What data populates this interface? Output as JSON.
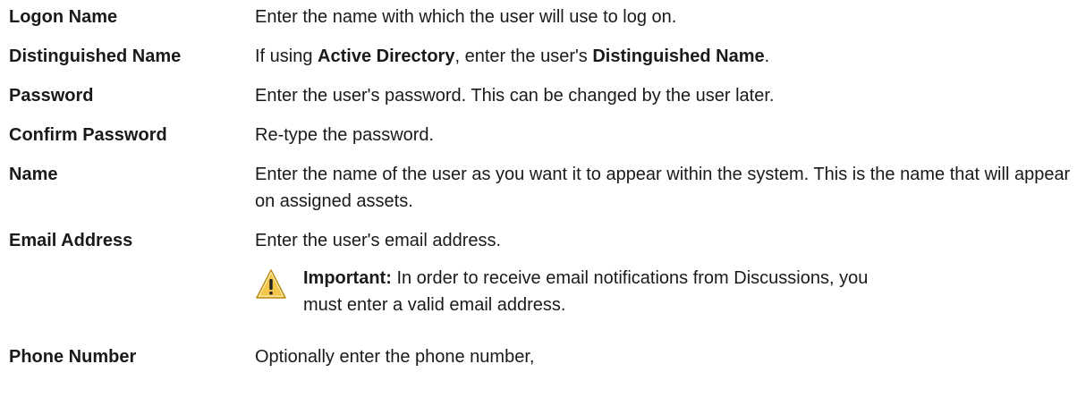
{
  "fields": [
    {
      "term": "Logon Name",
      "definition": "Enter the name with which the user will use to log on."
    },
    {
      "term": "Distinguished Name",
      "definition_prefix": "If using ",
      "definition_bold_1": "Active Directory",
      "definition_mid": ", enter the user's ",
      "definition_bold_2": "Distinguished Name",
      "definition_suffix": "."
    },
    {
      "term": "Password",
      "definition": "Enter the user's password. This can be changed by the user later."
    },
    {
      "term": "Confirm Password",
      "definition": "Re-type the password."
    },
    {
      "term": "Name",
      "definition": "Enter the name of the user as you want it to appear within the system. This is the name that will appear on assigned assets."
    },
    {
      "term": "Email Address",
      "definition": "Enter the user's email address.",
      "note": {
        "icon": "warning-icon",
        "label": "Important:",
        "text": " In order to receive email notifications from Discussions, you must enter a valid email address."
      }
    },
    {
      "term": "Phone Number",
      "definition": "Optionally enter the phone number,"
    }
  ],
  "colors": {
    "text": "#1a1a1a",
    "warning_fill": "#f4c64a",
    "warning_stroke": "#b98b12"
  }
}
